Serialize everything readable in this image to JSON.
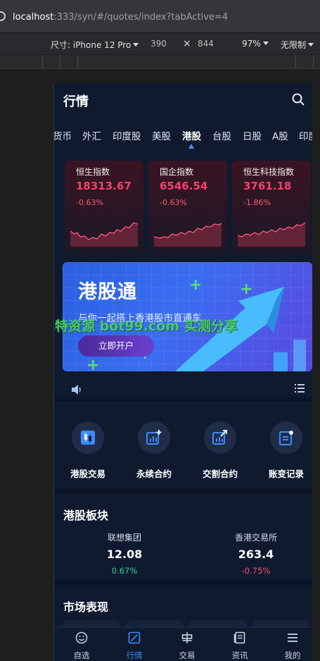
{
  "browser": {
    "url_host": "localhost",
    "url_rest": ":333/syn/#/quotes/index?tabActive=4"
  },
  "devtools": {
    "size_label": "尺寸: iPhone 12 Pro",
    "width": "390",
    "times": "×",
    "height": "844",
    "zoom": "97%",
    "throttle": "无限制"
  },
  "header": {
    "title": "行情",
    "search_icon": "search-icon"
  },
  "tabs": [
    {
      "label": "货币"
    },
    {
      "label": "外汇"
    },
    {
      "label": "印度股"
    },
    {
      "label": "美股"
    },
    {
      "label": "港股"
    },
    {
      "label": "台股"
    },
    {
      "label": "日股"
    },
    {
      "label": "A股"
    },
    {
      "label": "印度期"
    }
  ],
  "active_tab": "港股",
  "indices": [
    {
      "name": "恒生指数",
      "price": "18313.67",
      "change": "-0.63%"
    },
    {
      "name": "国企指数",
      "price": "6546.54",
      "change": "-0.63%"
    },
    {
      "name": "恒生科技指数",
      "price": "3761.18",
      "change": "-1.86%"
    }
  ],
  "banner": {
    "title": "港股通",
    "subtitle": "与你一起搭上香港股市直通车",
    "button": "立即开户"
  },
  "watermark": "比特资源 bot99.com 实测分享",
  "quick_actions": [
    {
      "label": "港股交易",
      "icon": "candlestick-icon"
    },
    {
      "label": "永续合约",
      "icon": "chart-plus-icon"
    },
    {
      "label": "交割合约",
      "icon": "chart-arrow-icon"
    },
    {
      "label": "账变记录",
      "icon": "ledger-icon"
    }
  ],
  "hk_sector": {
    "title": "港股板块",
    "stocks": [
      {
        "name": "联想集团",
        "price": "12.08",
        "change": "0.67%",
        "color": "#2fd59a"
      },
      {
        "name": "香港交易所",
        "price": "263.4",
        "change": "-0.75%",
        "color": "#ff4d6d"
      }
    ]
  },
  "market": {
    "title": "市场表现"
  },
  "tabbar": [
    {
      "label": "自选",
      "icon": "smiley-icon"
    },
    {
      "label": "行情",
      "icon": "trend-icon"
    },
    {
      "label": "交易",
      "icon": "exchange-icon"
    },
    {
      "label": "资讯",
      "icon": "news-icon"
    },
    {
      "label": "我的",
      "icon": "menu-icon"
    }
  ],
  "colors": {
    "accent": "#3d8bff",
    "down_red": "#ff3d6b",
    "up_green": "#2fd59a",
    "page_bg": "#0f1a2f"
  }
}
